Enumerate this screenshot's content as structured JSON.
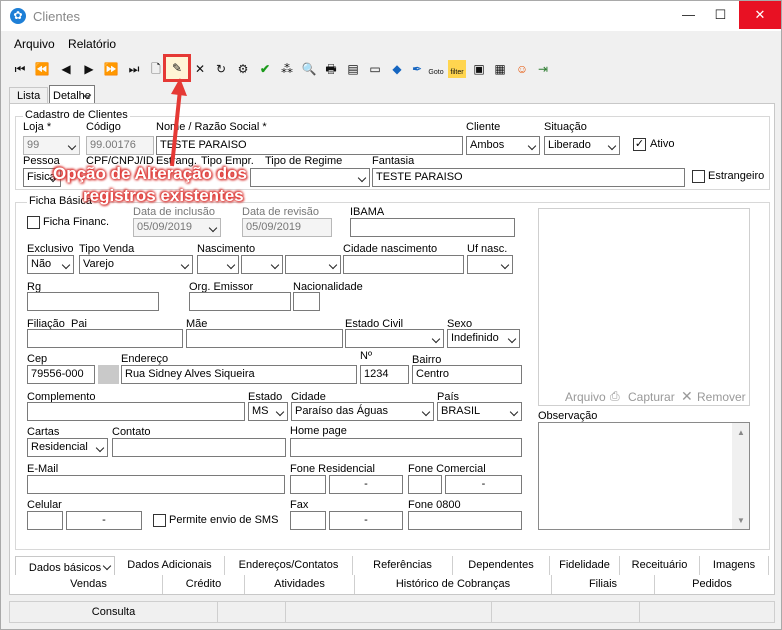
{
  "window": {
    "title": "Clientes"
  },
  "menu": {
    "file": "Arquivo",
    "report": "Relatório"
  },
  "toolbar": {
    "goto": "Goto",
    "filter": "filter"
  },
  "tabs": {
    "list": "Lista",
    "detail": "Detalhe"
  },
  "annotation": {
    "line1": "Opção de Alteração dos",
    "line2": "registros existentes"
  },
  "cadastro": {
    "title": "Cadastro de Clientes",
    "loja_label": "Loja *",
    "loja": "99",
    "codigo_label": "Código",
    "codigo": "99.00176",
    "nome_label": "Nome / Razão Social *",
    "nome": "TESTE PARAISO",
    "cliente_label": "Cliente",
    "cliente": "Ambos",
    "situacao_label": "Situação",
    "situacao": "Liberado",
    "ativo_label": "Ativo",
    "pessoa_label": "Pessoa",
    "pessoa": "Fisica",
    "cpf_label": "CPF/CNPJ/ID",
    "estrang_label": "Estrang.",
    "tipo_empr_label": "Tipo Empr.",
    "regime_label": "Tipo de Regime",
    "fantasia_label": "Fantasia",
    "fantasia": "TESTE PARAISO",
    "estrangeiro_label": "Estrangeiro"
  },
  "ficha": {
    "title": "Ficha Básica",
    "financ_label": "Ficha Financ.",
    "inclusao_label": "Data de inclusão",
    "inclusao": "05/09/2019",
    "revisao_label": "Data de revisão",
    "revisao": "05/09/2019",
    "ibama_label": "IBAMA",
    "exclusivo_label": "Exclusivo",
    "exclusivo": "Não",
    "tipovenda_label": "Tipo Venda",
    "tipovenda": "Varejo",
    "nascimento_label": "Nascimento",
    "cidade_nasc_label": "Cidade nascimento",
    "uf_nasc_label": "Uf nasc.",
    "rg_label": "Rg",
    "orgao_label": "Org. Emissor",
    "nacionalidade_label": "Nacionalidade",
    "filiacao_label": "Filiação",
    "pai_label": "Pai",
    "mae_label": "Mãe",
    "estado_civil_label": "Estado Civil",
    "sexo_label": "Sexo",
    "sexo": "Indefinido",
    "cep_label": "Cep",
    "cep": "79556-000",
    "endereco_label": "Endereço",
    "endereco": "Rua Sidney Alves Siqueira",
    "numero_label": "Nº",
    "numero": "1234",
    "bairro_label": "Bairro",
    "bairro": "Centro",
    "complemento_label": "Complemento",
    "estado_label": "Estado",
    "estado": "MS",
    "cidade_label": "Cidade",
    "cidade": "Paraíso das Águas",
    "pais_label": "País",
    "pais": "BRASIL",
    "cartas_label": "Cartas",
    "cartas": "Residencial",
    "contato_label": "Contato",
    "homepage_label": "Home page",
    "email_label": "E-Mail",
    "fone_res_label": "Fone Residencial",
    "fone_com_label": "Fone Comercial",
    "celular_label": "Celular",
    "sms_label": "Permite envio de SMS",
    "fax_label": "Fax",
    "fone0800_label": "Fone 0800",
    "dash": "-"
  },
  "photo": {
    "arquivo": "Arquivo",
    "capturar": "Capturar",
    "remover": "Remover"
  },
  "obs": {
    "label": "Observação"
  },
  "bottom_tabs": {
    "row1": [
      "Dados básicos",
      "Dados Adicionais",
      "Endereços/Contatos",
      "Referências",
      "Dependentes",
      "Fidelidade",
      "Receituário",
      "Imagens"
    ],
    "row2": [
      "Vendas",
      "Crédito",
      "Atividades",
      "Histórico de Cobranças",
      "Filiais",
      "Pedidos"
    ]
  },
  "status": {
    "consulta": "Consulta"
  }
}
